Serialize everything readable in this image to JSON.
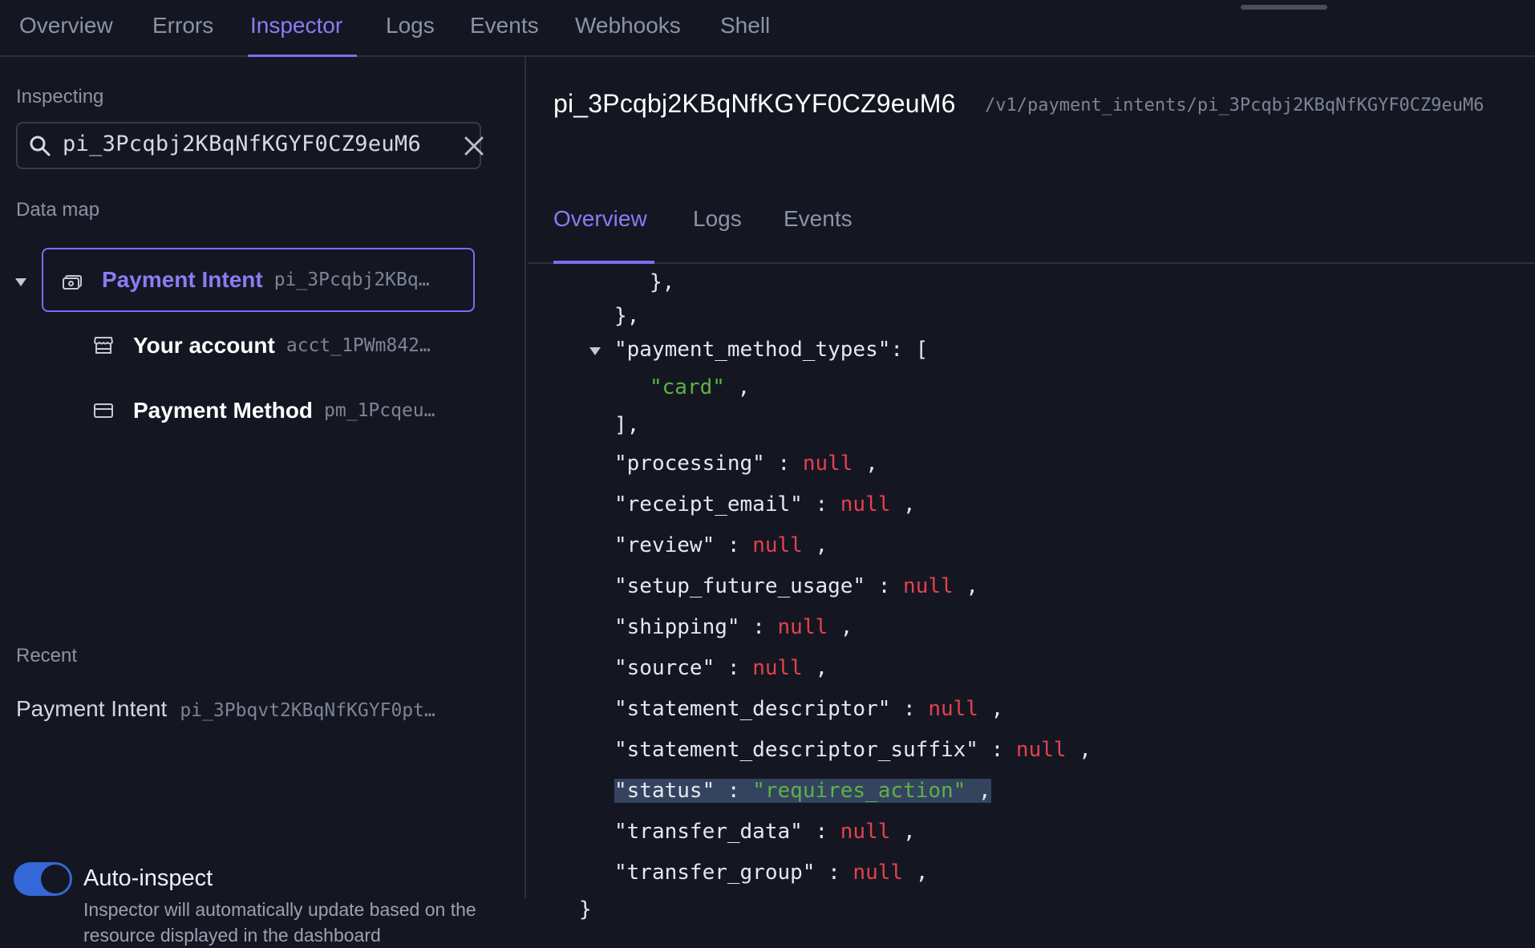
{
  "top_nav": {
    "tabs": [
      "Overview",
      "Errors",
      "Inspector",
      "Logs",
      "Events",
      "Webhooks",
      "Shell"
    ],
    "active": "Inspector"
  },
  "sidebar": {
    "inspecting_label": "Inspecting",
    "search": {
      "value": "pi_3Pcqbj2KBqNfKGYF0CZ9euM6",
      "icon": "search-icon",
      "clear_icon": "close-icon"
    },
    "data_map_label": "Data map",
    "tree": [
      {
        "title": "Payment Intent",
        "id": "pi_3Pcqbj2KBq…",
        "icon": "payment-intent-icon",
        "selected": true
      },
      {
        "title": "Your account",
        "id": "acct_1PWm842…",
        "icon": "store-icon",
        "selected": false
      },
      {
        "title": "Payment Method",
        "id": "pm_1Pcqeu…",
        "icon": "card-icon",
        "selected": false
      }
    ],
    "recent_label": "Recent",
    "recent": [
      {
        "title": "Payment Intent",
        "id": "pi_3Pbqvt2KBqNfKGYF0pt…"
      }
    ],
    "auto_inspect": {
      "enabled": true,
      "title": "Auto-inspect",
      "description": "Inspector will automatically update based on the resource displayed in the dashboard"
    }
  },
  "main": {
    "object_id": "pi_3Pcqbj2KBqNfKGYF0CZ9euM6",
    "object_path": "/v1/payment_intents/pi_3Pcqbj2KBqNfKGYF0CZ9euM6",
    "tabs": [
      "Overview",
      "Logs",
      "Events"
    ],
    "active_tab": "Overview",
    "code": {
      "close_inner": "},",
      "close_outer": "},",
      "pmt_key": "\"payment_method_types\"",
      "pmt_open": ": [",
      "pmt_item": "\"card\"",
      "pmt_close": "],",
      "fields": [
        {
          "key": "\"processing\"",
          "value": "null",
          "type": "null"
        },
        {
          "key": "\"receipt_email\"",
          "value": "null",
          "type": "null"
        },
        {
          "key": "\"review\"",
          "value": "null",
          "type": "null"
        },
        {
          "key": "\"setup_future_usage\"",
          "value": "null",
          "type": "null"
        },
        {
          "key": "\"shipping\"",
          "value": "null",
          "type": "null"
        },
        {
          "key": "\"source\"",
          "value": "null",
          "type": "null"
        },
        {
          "key": "\"statement_descriptor\"",
          "value": "null",
          "type": "null"
        },
        {
          "key": "\"statement_descriptor_suffix\"",
          "value": "null",
          "type": "null"
        },
        {
          "key": "\"status\"",
          "value": "\"requires_action\"",
          "type": "string",
          "highlighted": true
        },
        {
          "key": "\"transfer_data\"",
          "value": "null",
          "type": "null"
        },
        {
          "key": "\"transfer_group\"",
          "value": "null",
          "type": "null"
        }
      ],
      "close_root": "}"
    }
  },
  "colors": {
    "accent": "#7b6ef0",
    "null": "#e5404f",
    "string": "#5fb046",
    "highlight": "#34445f",
    "toggle": "#3467d8"
  }
}
